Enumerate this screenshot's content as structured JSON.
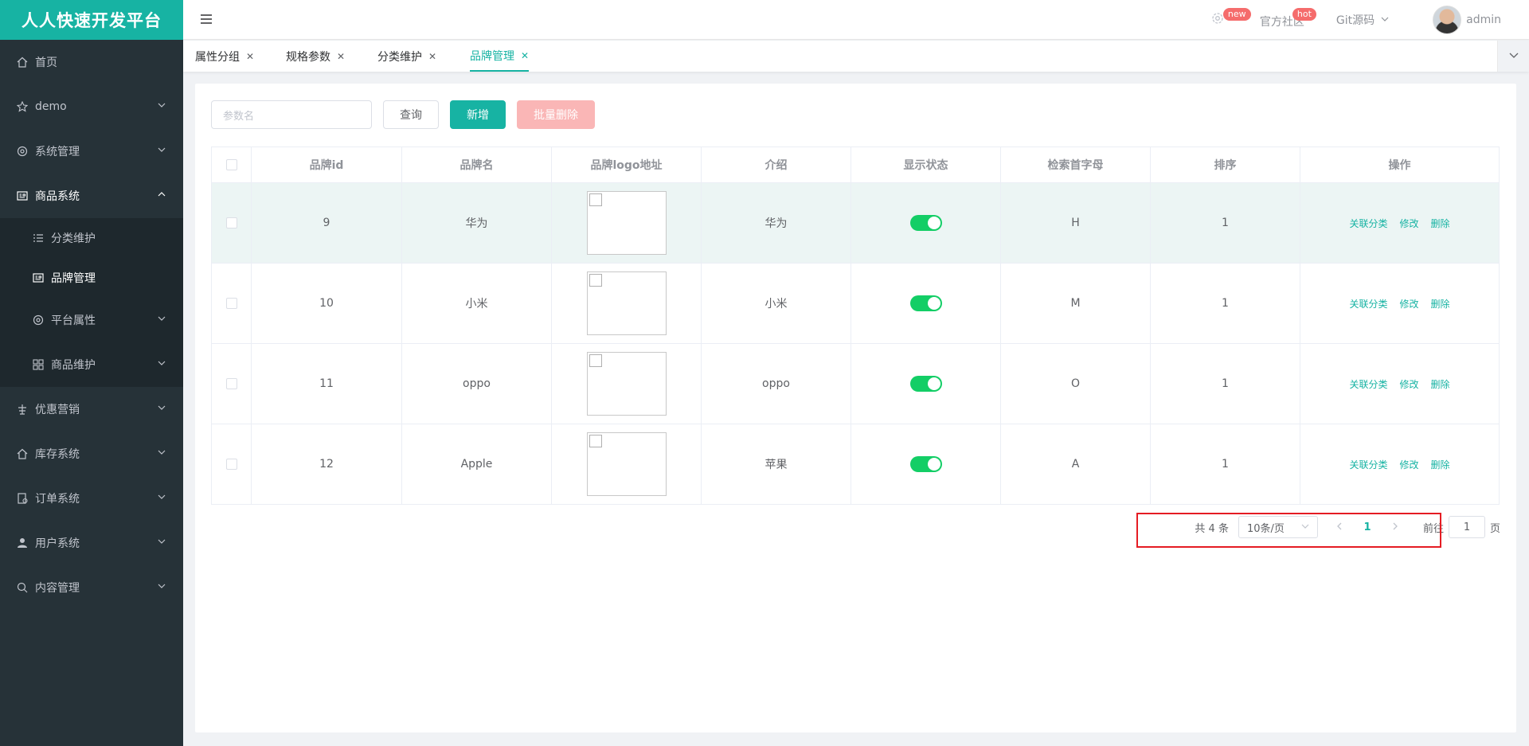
{
  "app": {
    "title": "人人快速开发平台"
  },
  "sidebar": {
    "items": [
      {
        "label": "首页"
      },
      {
        "label": "demo"
      },
      {
        "label": "系统管理"
      },
      {
        "label": "商品系统"
      },
      {
        "label": "分类维护"
      },
      {
        "label": "品牌管理"
      },
      {
        "label": "平台属性"
      },
      {
        "label": "商品维护"
      },
      {
        "label": "优惠营销"
      },
      {
        "label": "库存系统"
      },
      {
        "label": "订单系统"
      },
      {
        "label": "用户系统"
      },
      {
        "label": "内容管理"
      }
    ]
  },
  "navbar": {
    "badge_new": "new",
    "community": "官方社区",
    "badge_hot": "hot",
    "git": "Git源码",
    "user": "admin"
  },
  "tabs": [
    {
      "label": "属性分组"
    },
    {
      "label": "规格参数"
    },
    {
      "label": "分类维护"
    },
    {
      "label": "品牌管理"
    }
  ],
  "toolbar": {
    "search_placeholder": "参数名",
    "query": "查询",
    "add": "新增",
    "batch_delete": "批量删除"
  },
  "table": {
    "headers": [
      "品牌id",
      "品牌名",
      "品牌logo地址",
      "介绍",
      "显示状态",
      "检索首字母",
      "排序",
      "操作"
    ],
    "rows": [
      {
        "id": "9",
        "name": "华为",
        "desc": "华为",
        "letter": "H",
        "sort": "1",
        "show": true
      },
      {
        "id": "10",
        "name": "小米",
        "desc": "小米",
        "letter": "M",
        "sort": "1",
        "show": true
      },
      {
        "id": "11",
        "name": "oppo",
        "desc": "oppo",
        "letter": "O",
        "sort": "1",
        "show": true
      },
      {
        "id": "12",
        "name": "Apple",
        "desc": "苹果",
        "letter": "A",
        "sort": "1",
        "show": true
      }
    ],
    "ops": {
      "relate": "关联分类",
      "edit": "修改",
      "delete": "删除"
    }
  },
  "pagination": {
    "total": "共 4 条",
    "page_size": "10条/页",
    "current": "1",
    "goto_label": "前往",
    "goto_value": "1",
    "page_suffix": "页"
  },
  "colors": {
    "accent": "#17b3a3",
    "sidebar": "#263238",
    "switch_on": "#13ce66",
    "highlight": "#e51c23"
  }
}
